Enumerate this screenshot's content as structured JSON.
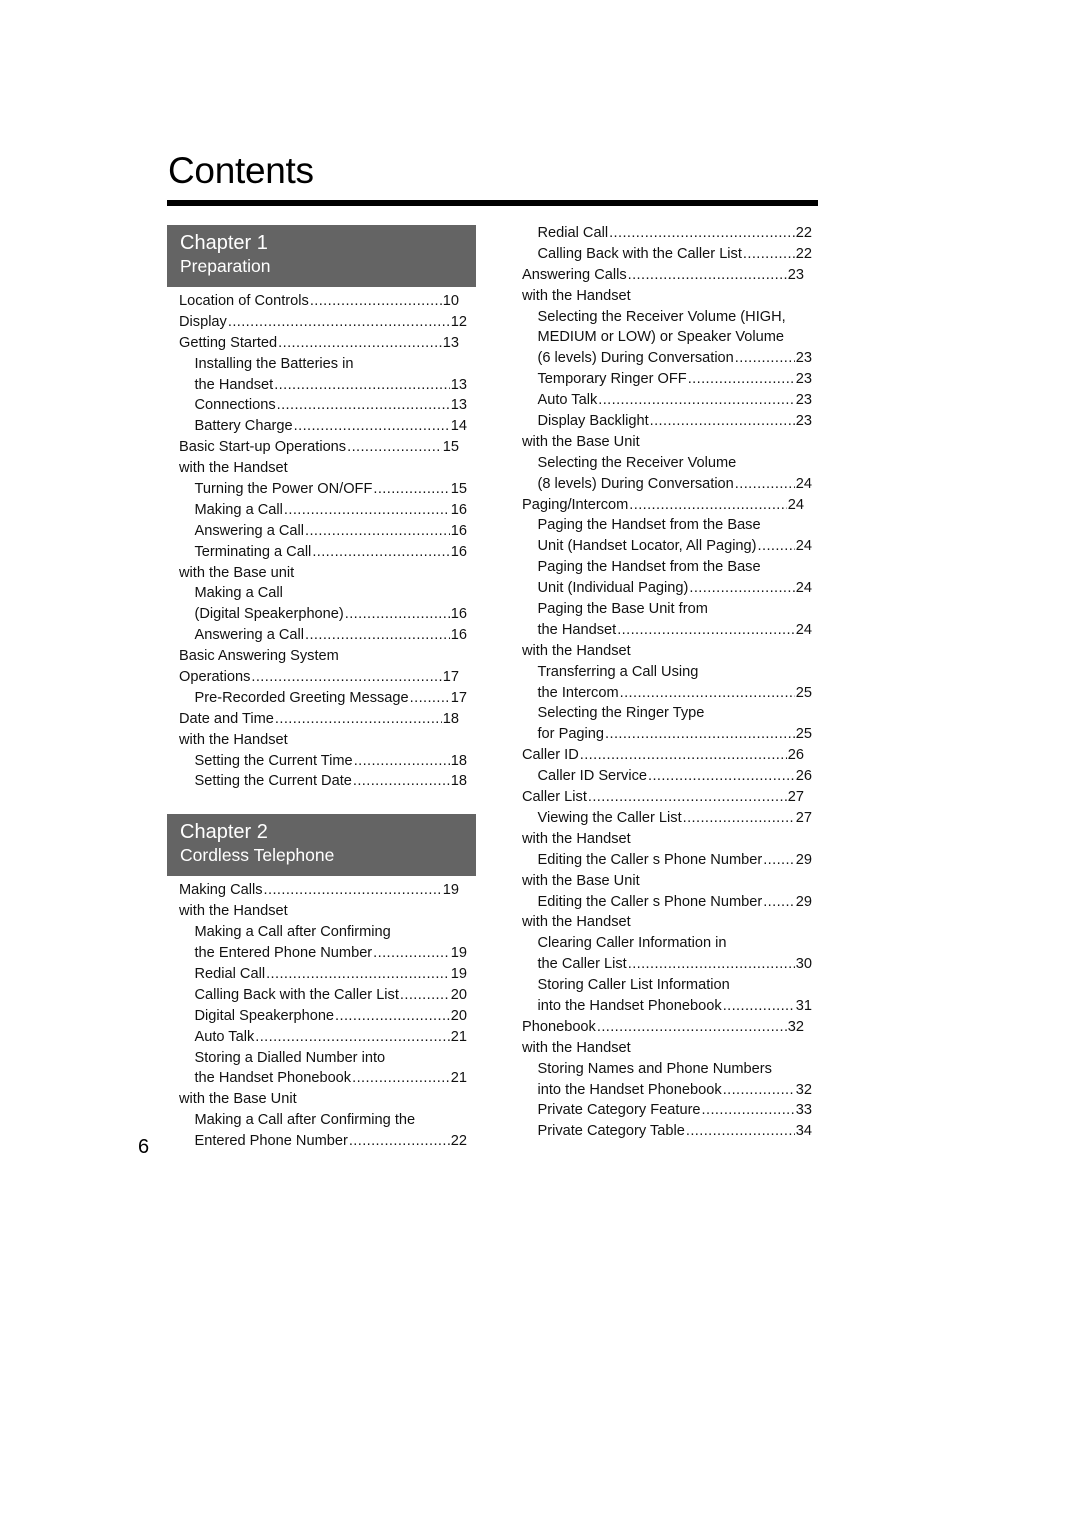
{
  "title": "Contents",
  "page_number": "6",
  "chapters": [
    {
      "number_label": "Chapter 1",
      "name": "Preparation",
      "entries": [
        {
          "text": "Location of Controls",
          "page": "10",
          "level": 1,
          "short": true
        },
        {
          "text": "Display",
          "page": "12",
          "level": 1
        },
        {
          "text": "Getting Started",
          "page": "13",
          "level": 1,
          "short": true
        },
        {
          "text": "Installing the Batteries in",
          "page": "",
          "level": 2
        },
        {
          "text": "the Handset",
          "page": "13",
          "level": 2
        },
        {
          "text": "Connections",
          "page": "13",
          "level": 2
        },
        {
          "text": "Battery Charge",
          "page": "14",
          "level": 2
        },
        {
          "text": "Basic Start-up Operations",
          "page": "15",
          "level": 1,
          "short": true
        },
        {
          "text": "with the Handset",
          "page": "",
          "level": 1
        },
        {
          "text": "Turning the Power ON/OFF",
          "page": "15",
          "level": 2
        },
        {
          "text": "Making a Call",
          "page": "16",
          "level": 2
        },
        {
          "text": "Answering a Call",
          "page": "16",
          "level": 2
        },
        {
          "text": "Terminating a Call",
          "page": "16",
          "level": 2
        },
        {
          "text": "with the Base unit",
          "page": "",
          "level": 1
        },
        {
          "text": "Making a Call",
          "page": "",
          "level": 2
        },
        {
          "text": "(Digital Speakerphone)",
          "page": "16",
          "level": 2
        },
        {
          "text": "Answering a Call",
          "page": "16",
          "level": 2
        },
        {
          "text": "Basic Answering System",
          "page": "",
          "level": 1
        },
        {
          "text": "Operations",
          "page": "17",
          "level": 1,
          "short": true
        },
        {
          "text": "Pre-Recorded Greeting Message",
          "page": "17",
          "level": 2
        },
        {
          "text": "Date and Time",
          "page": "18",
          "level": 1,
          "short": true
        },
        {
          "text": "with the Handset",
          "page": "",
          "level": 1
        },
        {
          "text": "Setting the Current Time",
          "page": "18",
          "level": 2
        },
        {
          "text": "Setting the Current Date",
          "page": "18",
          "level": 2
        }
      ]
    },
    {
      "number_label": "Chapter 2",
      "name": "Cordless Telephone",
      "entries": [
        {
          "text": "Making Calls",
          "page": "19",
          "level": 1,
          "short": true
        },
        {
          "text": "with the Handset",
          "page": "",
          "level": 1
        },
        {
          "text": "Making a Call after Confirming",
          "page": "",
          "level": 2
        },
        {
          "text": "the Entered Phone Number",
          "page": "19",
          "level": 2
        },
        {
          "text": "Redial Call",
          "page": "19",
          "level": 2
        },
        {
          "text": "Calling Back with the Caller List",
          "page": "20",
          "level": 2
        },
        {
          "text": "Digital Speakerphone",
          "page": "20",
          "level": 2
        },
        {
          "text": "Auto Talk",
          "page": "21",
          "level": 2
        },
        {
          "text": "Storing a Dialled Number into",
          "page": "",
          "level": 2
        },
        {
          "text": "the Handset Phonebook",
          "page": "21",
          "level": 2
        },
        {
          "text": "with the Base Unit",
          "page": "",
          "level": 1
        },
        {
          "text": "Making a Call after Confirming the",
          "page": "",
          "level": 2
        },
        {
          "text": "Entered Phone Number",
          "page": "22",
          "level": 2
        }
      ],
      "continued_entries": [
        {
          "text": "Redial Call",
          "page": "22",
          "level": 2
        },
        {
          "text": "Calling Back with the Caller List",
          "page": "22",
          "level": 2
        },
        {
          "text": "Answering Calls",
          "page": "23",
          "level": 1,
          "short": true
        },
        {
          "text": "with the Handset",
          "page": "",
          "level": 1
        },
        {
          "text": "Selecting the Receiver Volume (HIGH,",
          "page": "",
          "level": 2
        },
        {
          "text": "MEDIUM or LOW) or Speaker Volume",
          "page": "",
          "level": 2
        },
        {
          "text": "(6 levels) During Conversation",
          "page": "23",
          "level": 2
        },
        {
          "text": "Temporary Ringer OFF",
          "page": "23",
          "level": 2
        },
        {
          "text": "Auto Talk",
          "page": "23",
          "level": 2
        },
        {
          "text": "Display Backlight",
          "page": "23",
          "level": 2
        },
        {
          "text": "with the Base Unit",
          "page": "",
          "level": 1
        },
        {
          "text": "Selecting the Receiver Volume",
          "page": "",
          "level": 2
        },
        {
          "text": "(8 levels) During Conversation",
          "page": "24",
          "level": 2
        },
        {
          "text": "Paging/Intercom",
          "page": "24",
          "level": 1,
          "short": true
        },
        {
          "text": "Paging the Handset from the Base",
          "page": "",
          "level": 2
        },
        {
          "text": "Unit (Handset Locator, All Paging)",
          "page": "24",
          "level": 2
        },
        {
          "text": "Paging the Handset from the Base",
          "page": "",
          "level": 2
        },
        {
          "text": "Unit (Individual Paging)",
          "page": "24",
          "level": 2
        },
        {
          "text": "Paging the Base Unit from",
          "page": "",
          "level": 2
        },
        {
          "text": "the Handset",
          "page": "24",
          "level": 2
        },
        {
          "text": "with the Handset",
          "page": "",
          "level": 1
        },
        {
          "text": "Transferring a Call Using",
          "page": "",
          "level": 2
        },
        {
          "text": "the Intercom",
          "page": "25",
          "level": 2
        },
        {
          "text": "Selecting the Ringer Type",
          "page": "",
          "level": 2
        },
        {
          "text": "for Paging",
          "page": "25",
          "level": 2
        },
        {
          "text": "Caller ID",
          "page": "26",
          "level": 1,
          "short": true
        },
        {
          "text": "Caller ID Service",
          "page": "26",
          "level": 2
        },
        {
          "text": "Caller List",
          "page": "27",
          "level": 1,
          "short": true
        },
        {
          "text": "Viewing the Caller List",
          "page": "27",
          "level": 2
        },
        {
          "text": "with the Handset",
          "page": "",
          "level": 1
        },
        {
          "text": "Editing the Caller s Phone Number",
          "page": "29",
          "level": 2
        },
        {
          "text": "with the Base Unit",
          "page": "",
          "level": 1
        },
        {
          "text": "Editing the Caller s Phone Number",
          "page": "29",
          "level": 2
        },
        {
          "text": "with the Handset",
          "page": "",
          "level": 1
        },
        {
          "text": "Clearing Caller Information in",
          "page": "",
          "level": 2
        },
        {
          "text": "the Caller List",
          "page": "30",
          "level": 2
        },
        {
          "text": "Storing Caller List Information",
          "page": "",
          "level": 2
        },
        {
          "text": "into the Handset Phonebook",
          "page": "31",
          "level": 2
        },
        {
          "text": "Phonebook",
          "page": "32",
          "level": 1,
          "short": true
        },
        {
          "text": "with the Handset",
          "page": "",
          "level": 1
        },
        {
          "text": "Storing Names and Phone Numbers",
          "page": "",
          "level": 2
        },
        {
          "text": "into the Handset Phonebook",
          "page": "32",
          "level": 2
        },
        {
          "text": "Private Category Feature",
          "page": "33",
          "level": 2
        },
        {
          "text": "Private Category Table",
          "page": "34",
          "level": 2
        }
      ]
    }
  ]
}
